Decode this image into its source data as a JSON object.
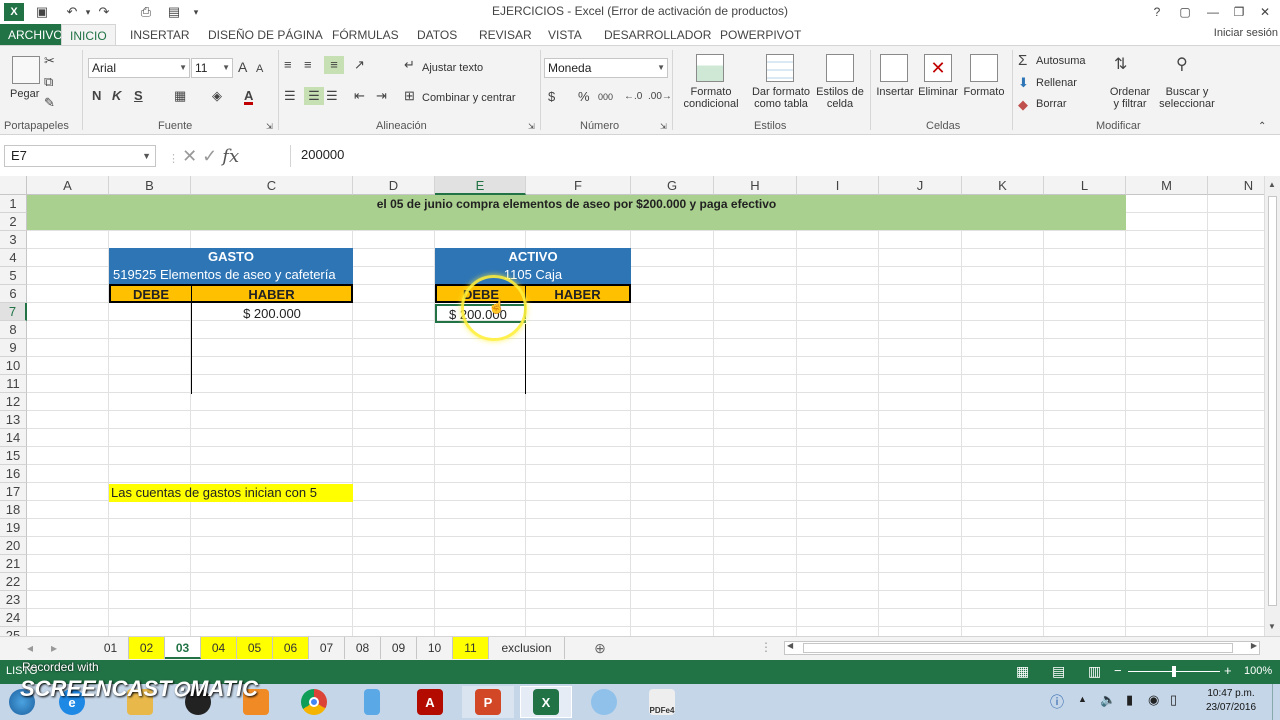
{
  "window": {
    "title": "EJERCICIOS - Excel (Error de activación de productos)",
    "help": "?",
    "restore": "▢",
    "minimize": "—",
    "maximize": "❐",
    "close": "✕"
  },
  "ribbon_tabs": [
    "ARCHIVO",
    "INICIO",
    "INSERTAR",
    "DISEÑO DE PÁGINA",
    "FÓRMULAS",
    "DATOS",
    "REVISAR",
    "VISTA",
    "DESARROLLADOR",
    "POWERPIVOT"
  ],
  "active_tab": "INICIO",
  "signin": "Iniciar sesión",
  "ribbon": {
    "paste": "Pegar",
    "clipboard_group": "Portapapeles",
    "font_name": "Arial",
    "font_size": "11",
    "bold": "N",
    "italic": "K",
    "underline": "S",
    "font_group": "Fuente",
    "wrap_text": "Ajustar texto",
    "merge_center": "Combinar y centrar",
    "align_group": "Alineación",
    "number_format": "Moneda",
    "currency": "$",
    "percent": "%",
    "thousands": "000",
    "number_group": "Número",
    "cond_format": [
      "Formato",
      "condicional"
    ],
    "format_table": [
      "Dar formato",
      "como tabla"
    ],
    "cell_styles": [
      "Estilos de",
      "celda"
    ],
    "styles_group": "Estilos",
    "insert": "Insertar",
    "delete": "Eliminar",
    "format": "Formato",
    "cells_group": "Celdas",
    "autosum": "Autosuma",
    "fill": "Rellenar",
    "clear": "Borrar",
    "sort_filter": [
      "Ordenar",
      "y filtrar"
    ],
    "find_select": [
      "Buscar y",
      "seleccionar"
    ],
    "modify_group": "Modificar"
  },
  "formula_bar": {
    "name_box": "E7",
    "formula": "200000",
    "fx": "fx"
  },
  "columns": [
    "A",
    "B",
    "C",
    "D",
    "E",
    "F",
    "G",
    "H",
    "I",
    "J",
    "K",
    "L",
    "M",
    "N"
  ],
  "selected_column": "E",
  "selected_row": "7",
  "rows": [
    "1",
    "2",
    "3",
    "4",
    "5",
    "6",
    "7",
    "8",
    "9",
    "10",
    "11",
    "12",
    "13",
    "14",
    "15",
    "16",
    "17",
    "18",
    "19",
    "20",
    "21",
    "22",
    "23",
    "24",
    "25"
  ],
  "cells": {
    "title": "el 05 de junio compra elementos de aseo por $200.000 y paga efectivo",
    "gasto_header": "GASTO",
    "gasto_account": "519525 Elementos de aseo y cafetería",
    "gasto_debe": "DEBE",
    "gasto_haber": "HABER",
    "gasto_haber_value": "$ 200.000",
    "activo_header": "ACTIVO",
    "activo_account": "1105 Caja",
    "activo_debe": "DEBE",
    "activo_haber": "HABER",
    "activo_debe_value": "$ 200.000",
    "note": "Las cuentas de gastos inician con 5"
  },
  "colors": {
    "excel_green": "#217346",
    "title_band": "#a9d08e",
    "account_blue": "#2e75b6",
    "debe_haber_gold": "#ffc000",
    "note_yellow": "#ffff00",
    "cursor_highlight": "#ffff33"
  },
  "sheets": [
    {
      "name": "01",
      "highlight": false
    },
    {
      "name": "02",
      "highlight": true
    },
    {
      "name": "03",
      "highlight": false,
      "active": true
    },
    {
      "name": "04",
      "highlight": true
    },
    {
      "name": "05",
      "highlight": true
    },
    {
      "name": "06",
      "highlight": true
    },
    {
      "name": "07",
      "highlight": false
    },
    {
      "name": "08",
      "highlight": false
    },
    {
      "name": "09",
      "highlight": false
    },
    {
      "name": "10",
      "highlight": false
    },
    {
      "name": "11",
      "highlight": true
    },
    {
      "name": "exclusion",
      "highlight": false
    }
  ],
  "status": {
    "mode": "LISTO",
    "zoom": "100%",
    "zoom_minus": "−",
    "zoom_plus": "+"
  },
  "watermark": {
    "recorded": "Recorded with",
    "brand": "SCREENCAST⊙MATIC"
  },
  "taskbar": {
    "time": "10:47 p.m.",
    "date": "23/07/2016",
    "apps": [
      "ie",
      "folder",
      "media",
      "chrome",
      "device",
      "acrobat",
      "powerpoint",
      "excel",
      "dvd",
      "pdf"
    ],
    "pdf_label": "PDFe4"
  }
}
